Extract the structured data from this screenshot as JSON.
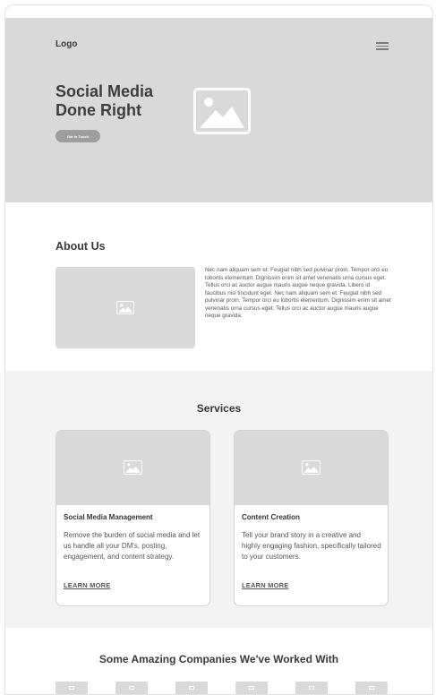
{
  "header": {
    "logo": "Logo",
    "menu_icon": "hamburger-menu-icon"
  },
  "hero": {
    "title": "Social Media Done Right",
    "cta_label": "Get In Touch",
    "image_icon": "image-placeholder-icon"
  },
  "about": {
    "title": "About Us",
    "image_icon": "image-placeholder-icon",
    "text": "Nec nam aliquam sem et. Feugiat nibh sed pulvinar proin. Tempor orci eu lobortis elementum. Dignissim enim sit amet venenatis urna cursus eget. Tellus orci ac auctor augue mauris augue neque gravida. Libero id faucibus nisl tincidunt eget. Nec nam aliquam sem et. Feugiat nibh sed pulvinar proin. Tempor orci eu lobortis elementum. Dignissim enim sit amet venenatis urna cursus eget. Tellus orci ac auctor augue mauris augue neque gravida."
  },
  "services": {
    "title": "Services",
    "cards": [
      {
        "title": "Social Media Management",
        "text": "Remove the burden of social media and let us handle all your DM's, posting, engagement, and content strategy.",
        "link": "LEARN MORE"
      },
      {
        "title": "Content Creation",
        "text": "Tell your brand story in a creative and highly engaging fashion, specifically tailored to your customers.",
        "link": "LEARN MORE"
      }
    ]
  },
  "companies": {
    "title": "Some Amazing Companies We've Worked With",
    "logo_icon": "company-logo-placeholder-icon"
  },
  "colors": {
    "placeholder_gray": "#d9d9d9",
    "section_gray": "#f3f3f3",
    "button_gray": "#9d9d9d",
    "text_dark": "#3a3a3a"
  }
}
